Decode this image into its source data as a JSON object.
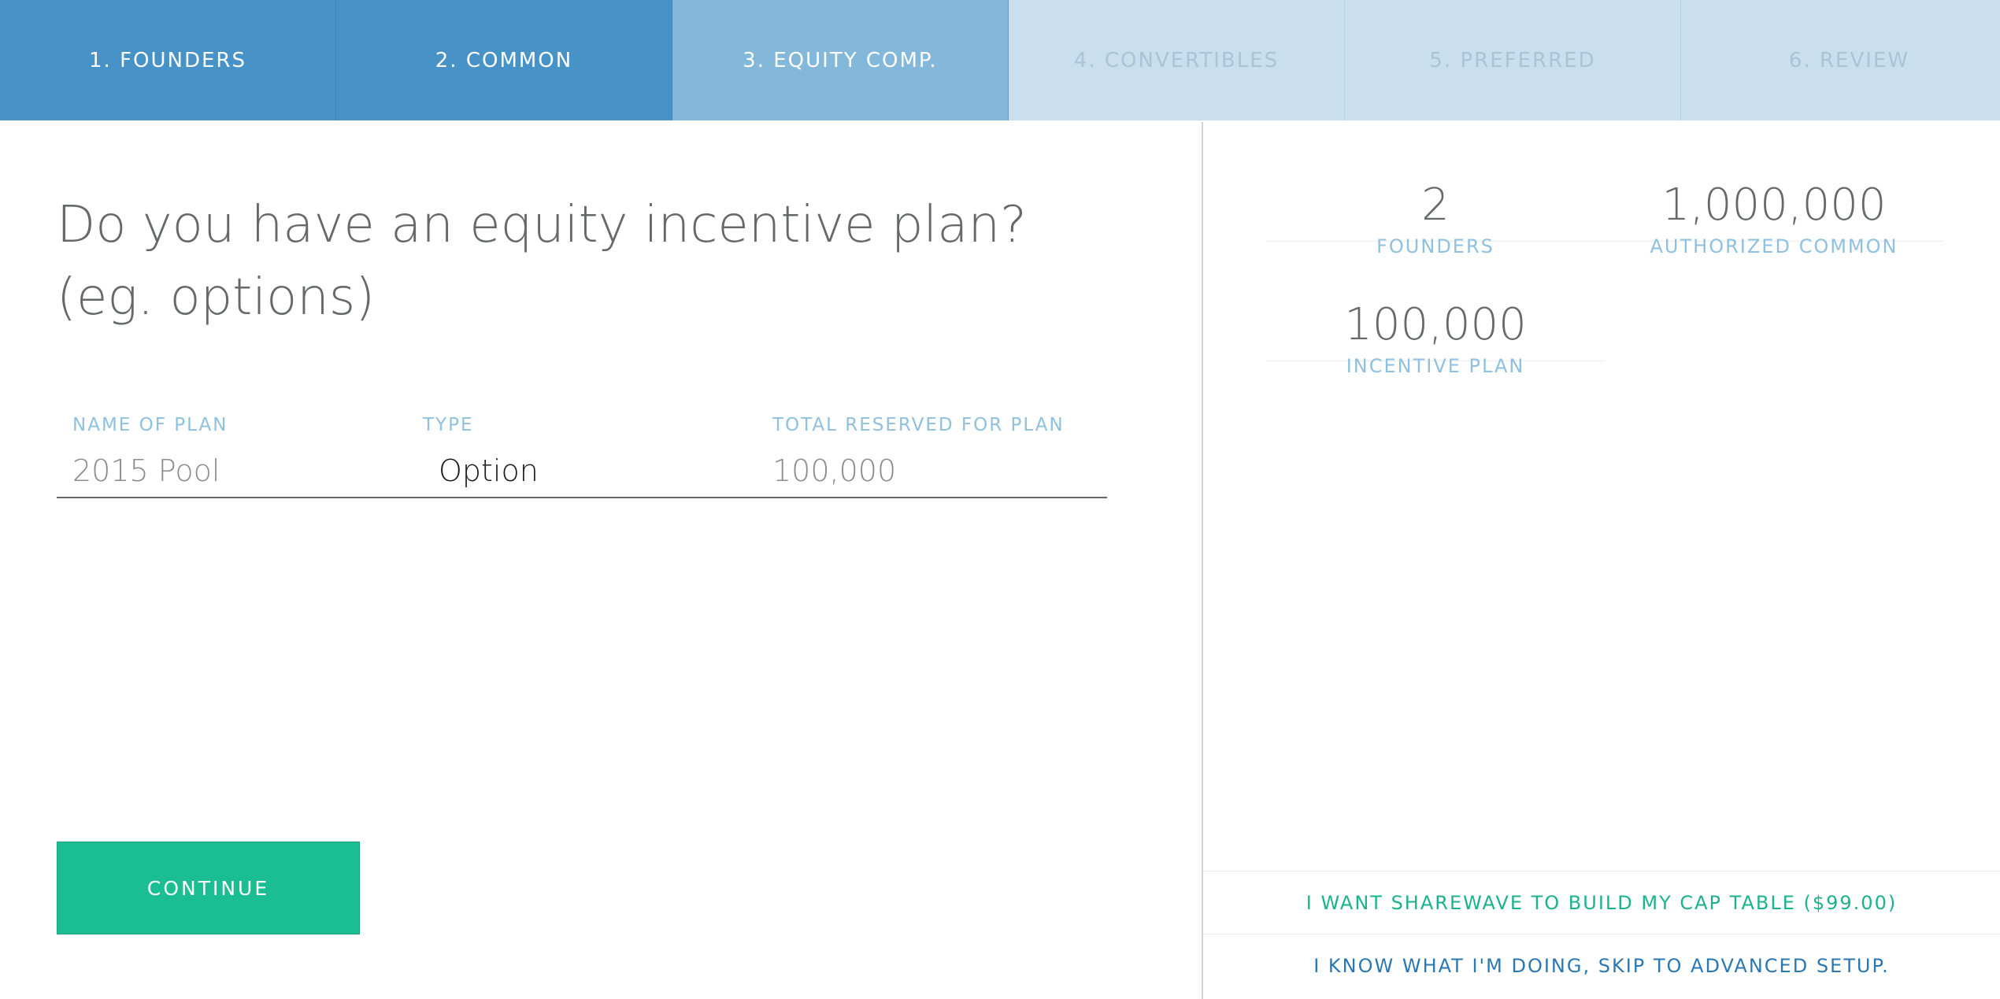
{
  "steps": [
    {
      "label": "1. FOUNDERS",
      "state": "done"
    },
    {
      "label": "2. COMMON",
      "state": "done"
    },
    {
      "label": "3. EQUITY COMP.",
      "state": "active"
    },
    {
      "label": "4. CONVERTIBLES",
      "state": "todo"
    },
    {
      "label": "5. PREFERRED",
      "state": "todo"
    },
    {
      "label": "6. REVIEW",
      "state": "todo"
    }
  ],
  "main": {
    "question": "Do you have an equity incentive plan? (eg. options)",
    "table": {
      "headers": [
        "NAME OF PLAN",
        "TYPE",
        "TOTAL RESERVED FOR PLAN"
      ],
      "row": {
        "name": "2015 Pool",
        "type": "Option",
        "total": "100,000"
      }
    },
    "continue_label": "CONTINUE"
  },
  "summary": {
    "founders": {
      "value": "2",
      "label": "FOUNDERS"
    },
    "authorized_common": {
      "value": "1,000,000",
      "label": "AUTHORIZED COMMON"
    },
    "incentive_plan": {
      "value": "100,000",
      "label": "INCENTIVE PLAN"
    }
  },
  "actions": {
    "build_label": "I WANT SHAREWAVE TO BUILD MY CAP TABLE ($99.00)",
    "skip_label": "I KNOW WHAT I'M DOING, SKIP TO ADVANCED SETUP."
  },
  "colors": {
    "step_done": "#4792c6",
    "step_active": "#84b8da",
    "step_todo": "#c9dfee",
    "accent_green": "#1bbd93",
    "label_blue": "#8ec1e0",
    "link_blue": "#2a78b3"
  }
}
